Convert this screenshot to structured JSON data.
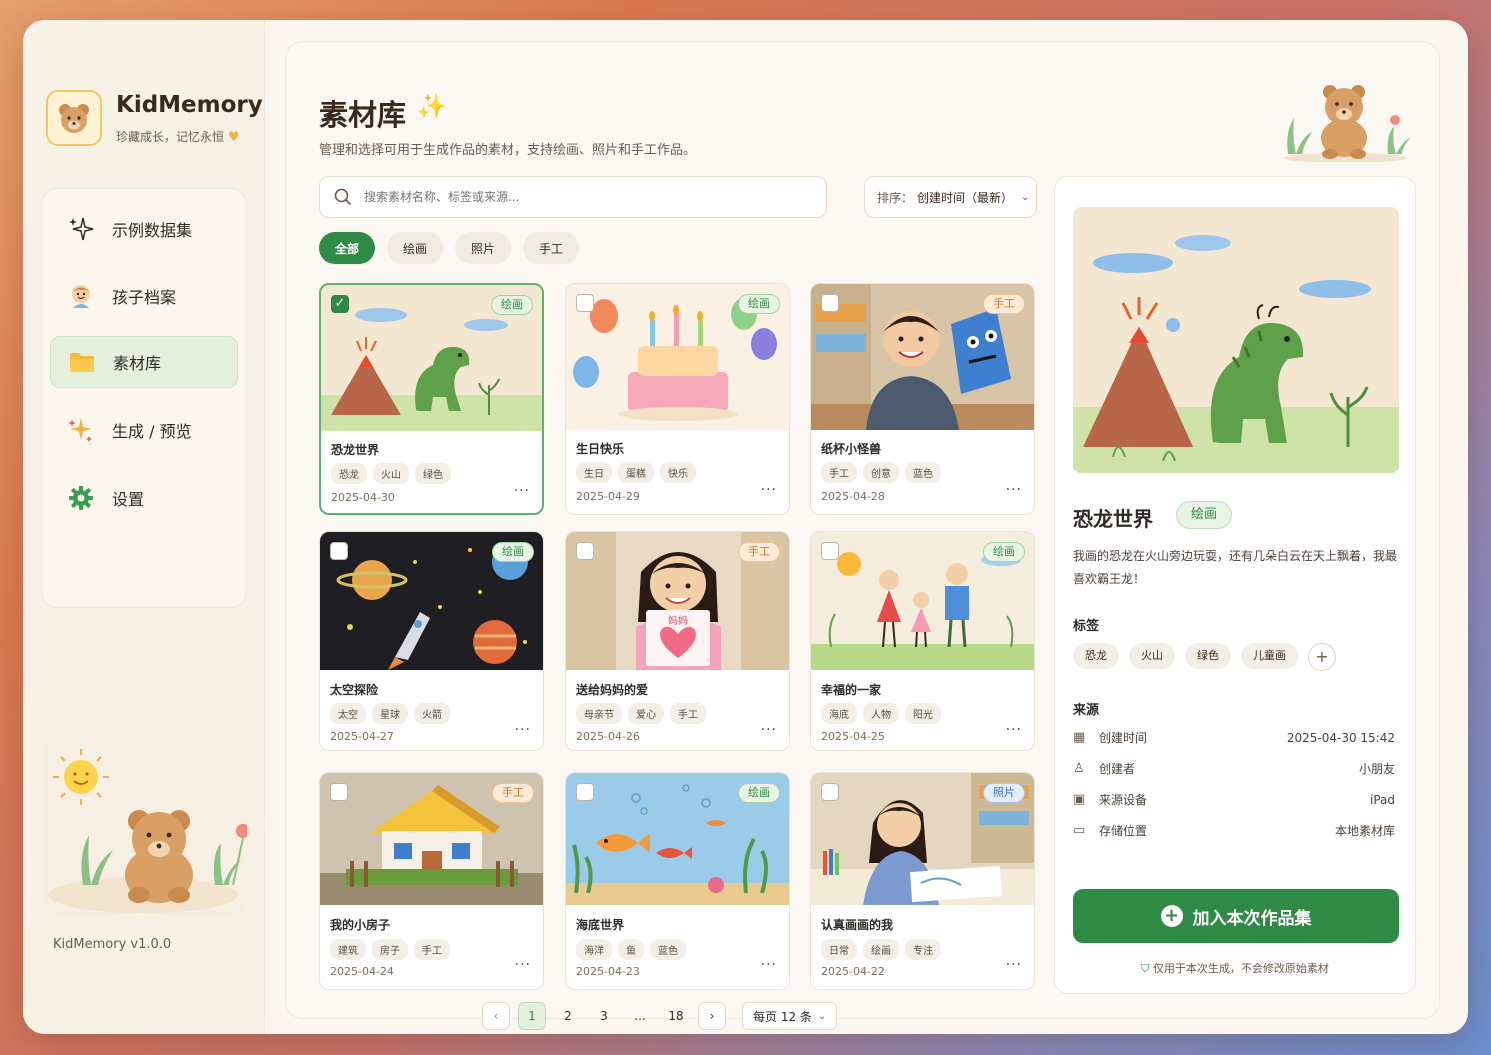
{
  "app": {
    "name": "KidMemory",
    "tagline": "珍藏成长，记忆永恒",
    "version": "KidMemory   v1.0.0"
  },
  "sidebar": {
    "items": [
      {
        "label": "示例数据集",
        "icon": "sparkle-icon"
      },
      {
        "label": "孩子档案",
        "icon": "child-icon"
      },
      {
        "label": "素材库",
        "icon": "folder-icon",
        "active": true
      },
      {
        "label": "生成 / 预览",
        "icon": "magic-icon"
      },
      {
        "label": "设置",
        "icon": "gear-icon"
      }
    ]
  },
  "header": {
    "title": "素材库",
    "subtitle": "管理和选择可用于生成作品的素材，支持绘画、照片和手工作品。"
  },
  "search": {
    "placeholder": "搜索素材名称、标签或来源..."
  },
  "sort": {
    "label": "排序：",
    "value": "创建时间（最新）"
  },
  "filters": [
    "全部",
    "绘画",
    "照片",
    "手工"
  ],
  "cards": [
    {
      "name": "恐龙世界",
      "type": "绘画",
      "tags": [
        "恐龙",
        "火山",
        "绿色"
      ],
      "date": "2025-04-30",
      "selected": true
    },
    {
      "name": "生日快乐",
      "type": "绘画",
      "tags": [
        "生日",
        "蛋糕",
        "快乐"
      ],
      "date": "2025-04-29"
    },
    {
      "name": "纸杯小怪兽",
      "type": "手工",
      "tags": [
        "手工",
        "创意",
        "蓝色"
      ],
      "date": "2025-04-28"
    },
    {
      "name": "太空探险",
      "type": "绘画",
      "tags": [
        "太空",
        "星球",
        "火箭"
      ],
      "date": "2025-04-27"
    },
    {
      "name": "送给妈妈的爱",
      "type": "手工",
      "tags": [
        "母亲节",
        "爱心",
        "手工"
      ],
      "date": "2025-04-26",
      "thumb_text": "妈妈"
    },
    {
      "name": "幸福的一家",
      "type": "绘画",
      "tags": [
        "海底",
        "人物",
        "阳光"
      ],
      "date": "2025-04-25"
    },
    {
      "name": "我的小房子",
      "type": "手工",
      "tags": [
        "建筑",
        "房子",
        "手工"
      ],
      "date": "2025-04-24"
    },
    {
      "name": "海底世界",
      "type": "绘画",
      "tags": [
        "海洋",
        "鱼",
        "蓝色"
      ],
      "date": "2025-04-23"
    },
    {
      "name": "认真画画的我",
      "type": "照片",
      "tags": [
        "日常",
        "绘画",
        "专注"
      ],
      "date": "2025-04-22"
    }
  ],
  "more_label": "···",
  "pagination": {
    "prev": "‹",
    "next": "›",
    "pages": [
      "1",
      "2",
      "3",
      "...",
      "18"
    ],
    "current": "1",
    "per_page": "每页 12 条"
  },
  "detail": {
    "title": "恐龙世界",
    "type": "绘画",
    "description": "我画的恐龙在火山旁边玩耍，还有几朵白云在天上飘着，我最喜欢霸王龙！",
    "tags_label": "标签",
    "tags": [
      "恐龙",
      "火山",
      "绿色",
      "儿童画"
    ],
    "add_tag": "+",
    "source_label": "来源",
    "meta": [
      {
        "label": "创建时间",
        "value": "2025-04-30 15:42",
        "icon": "calendar-icon"
      },
      {
        "label": "创建者",
        "value": "小朋友",
        "icon": "user-icon"
      },
      {
        "label": "来源设备",
        "value": "iPad",
        "icon": "device-icon"
      },
      {
        "label": "存储位置",
        "value": "本地素材库",
        "icon": "folder-icon"
      }
    ],
    "add_button": "加入本次作品集",
    "note": "仅用于本次生成，不会修改原始素材"
  },
  "colors": {
    "accent": "#2f8a45",
    "accent_light": "#e4f0dc",
    "craft": "#d1772a",
    "photo": "#3f72c4",
    "background": "#fbf6ee"
  }
}
